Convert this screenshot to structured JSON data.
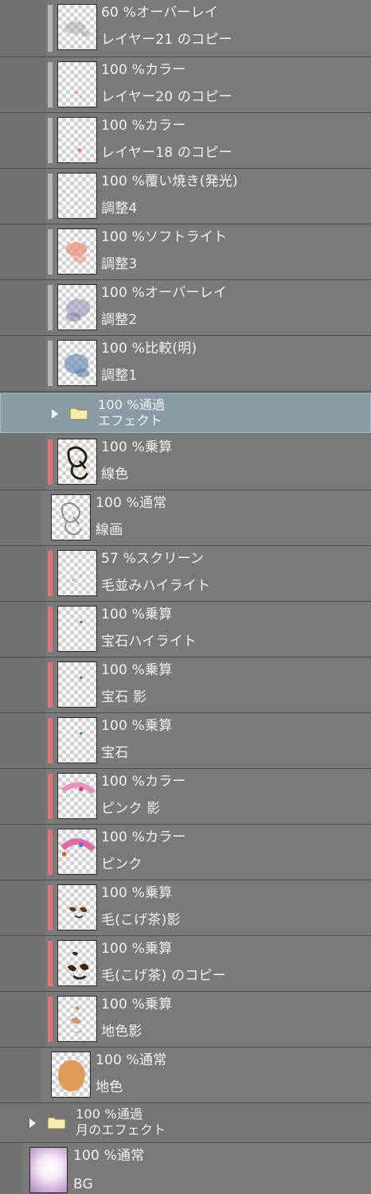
{
  "colors": {
    "panel_bg": "#727272",
    "clip_bar": "#e07373",
    "plain_bar": "#b5b5b5",
    "selected_bg": "#8b9ba6"
  },
  "layers": [
    {
      "line1": "60 %オーバーレイ",
      "line2": "レイヤー21 のコピー",
      "thumb_icon": "thumb-gray-smudge-icon"
    },
    {
      "line1": "100 %カラー",
      "line2": "レイヤー20 のコピー",
      "thumb_icon": "thumb-pink-dots-icon"
    },
    {
      "line1": "100 %カラー",
      "line2": "レイヤー18 のコピー",
      "thumb_icon": "thumb-pink-dot-icon"
    },
    {
      "line1": "100 %覆い焼き(発光)",
      "line2": "調整4",
      "thumb_icon": "thumb-empty-icon"
    },
    {
      "line1": "100 %ソフトライト",
      "line2": "調整3",
      "thumb_icon": "thumb-salmon-blob-icon"
    },
    {
      "line1": "100 %オーバーレイ",
      "line2": "調整2",
      "thumb_icon": "thumb-purple-blob-icon"
    },
    {
      "line1": "100 %比較(明)",
      "line2": "調整1",
      "thumb_icon": "thumb-blue-blob-icon"
    },
    {
      "line1": "100 %通過",
      "line2": "エフェクト",
      "thumb_icon": "folder-icon"
    },
    {
      "line1": "100 %乗算",
      "line2": "線色",
      "thumb_icon": "thumb-dark-lineart-icon"
    },
    {
      "line1": "100 %通常",
      "line2": "線画",
      "thumb_icon": "thumb-gray-lineart-icon"
    },
    {
      "line1": "57 %スクリーン",
      "line2": "毛並みハイライト",
      "thumb_icon": "thumb-faint-dots-icon"
    },
    {
      "line1": "100 %乗算",
      "line2": "宝石ハイライト",
      "thumb_icon": "thumb-blue-dot-icon"
    },
    {
      "line1": "100 %乗算",
      "line2": "宝石 影",
      "thumb_icon": "thumb-blue-dot-icon"
    },
    {
      "line1": "100 %乗算",
      "line2": "宝石",
      "thumb_icon": "thumb-blue-dot-icon"
    },
    {
      "line1": "100 %カラー",
      "line2": "ピンク 影",
      "thumb_icon": "thumb-pink-arc-icon"
    },
    {
      "line1": "100 %カラー",
      "line2": "ピンク",
      "thumb_icon": "thumb-pink-arc-icon"
    },
    {
      "line1": "100 %乗算",
      "line2": "毛(こげ茶)影",
      "thumb_icon": "thumb-brown-marks-icon"
    },
    {
      "line1": "100 %乗算",
      "line2": "毛(こげ茶) のコピー",
      "thumb_icon": "thumb-brown-marks-icon"
    },
    {
      "line1": "100 %乗算",
      "line2": "地色影",
      "thumb_icon": "thumb-tan-marks-icon"
    },
    {
      "line1": "100 %通常",
      "line2": "地色",
      "thumb_icon": "thumb-orange-fill-icon"
    },
    {
      "line1": "100 %通過",
      "line2": "月のエフェクト",
      "thumb_icon": "folder-icon"
    },
    {
      "line1": "100 %通常",
      "line2": "BG",
      "thumb_icon": "thumb-moon-glow-icon"
    }
  ]
}
